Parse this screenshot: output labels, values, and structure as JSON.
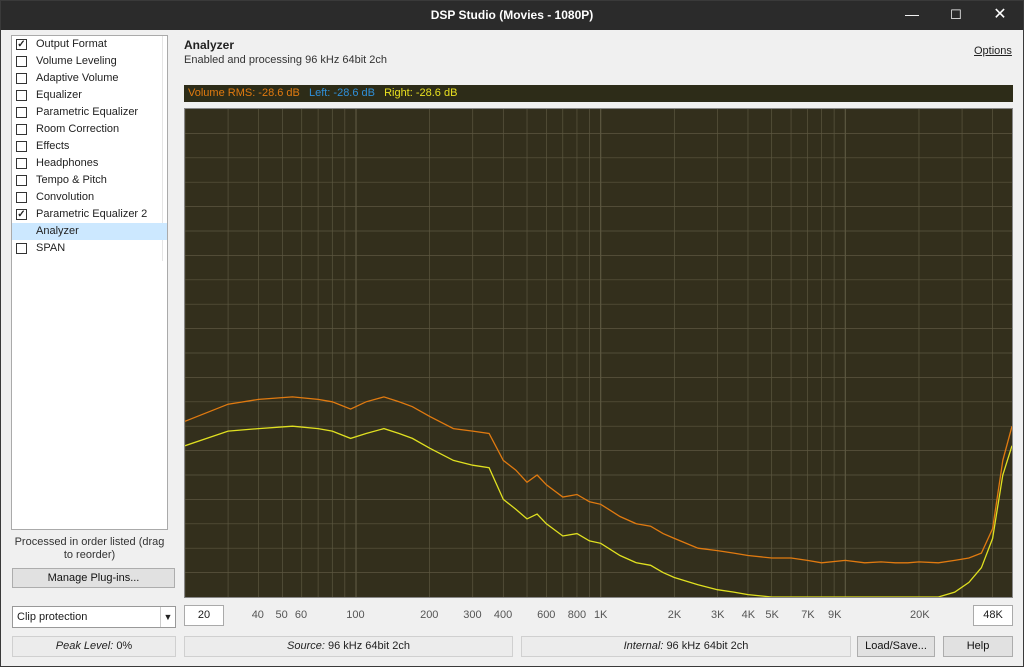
{
  "window": {
    "title": "DSP Studio (Movies - 1080P)",
    "minimize_glyph": "—",
    "maximize_glyph": "☐",
    "close_glyph": "✕"
  },
  "sidebar": {
    "items": [
      {
        "label": "Output Format",
        "checked": true
      },
      {
        "label": "Volume Leveling",
        "checked": false
      },
      {
        "label": "Adaptive Volume",
        "checked": false
      },
      {
        "label": "Equalizer",
        "checked": false
      },
      {
        "label": "Parametric Equalizer",
        "checked": false
      },
      {
        "label": "Room Correction",
        "checked": false
      },
      {
        "label": "Effects",
        "checked": false
      },
      {
        "label": "Headphones",
        "checked": false
      },
      {
        "label": "Tempo & Pitch",
        "checked": false
      },
      {
        "label": "Convolution",
        "checked": false
      },
      {
        "label": "Parametric Equalizer 2",
        "checked": true
      },
      {
        "label": "Analyzer",
        "checked": null,
        "selected": true
      },
      {
        "label": "SPAN",
        "checked": false
      }
    ],
    "order_note": "Processed in order listed (drag to reorder)",
    "manage_button": "Manage Plug-ins..."
  },
  "header": {
    "title": "Analyzer",
    "status": "Enabled and processing 96 kHz 64bit 2ch",
    "options_link": "Options"
  },
  "rms": {
    "volume": "Volume RMS: -28.6 dB",
    "left": "Left: -28.6 dB",
    "right": "Right: -28.6 dB",
    "volume_color": "#e07a10",
    "left_color": "#2f8fd8",
    "right_color": "#e8e020"
  },
  "frequency_range": {
    "min_value": "20",
    "max_value": "48K",
    "ticks": [
      "40",
      "50",
      "60",
      "100",
      "200",
      "300",
      "400",
      "600",
      "800",
      "1K",
      "2K",
      "3K",
      "4K",
      "5K",
      "7K",
      "9K",
      "20K"
    ]
  },
  "spectrum": {
    "x_hz": [
      20,
      30,
      40,
      55,
      70,
      80,
      95,
      110,
      130,
      150,
      170,
      200,
      250,
      300,
      350,
      400,
      450,
      500,
      550,
      600,
      700,
      800,
      900,
      1000,
      1200,
      1400,
      1600,
      1800,
      2000,
      2500,
      3000,
      3500,
      4000,
      5000,
      6000,
      7000,
      8000,
      10000,
      12000,
      14000,
      16000,
      18000,
      20000,
      24000,
      28000,
      32000,
      36000,
      40000,
      44000,
      48000
    ],
    "orange_level": [
      0.64,
      0.605,
      0.595,
      0.59,
      0.595,
      0.6,
      0.615,
      0.6,
      0.59,
      0.6,
      0.61,
      0.63,
      0.655,
      0.66,
      0.665,
      0.72,
      0.74,
      0.765,
      0.75,
      0.77,
      0.795,
      0.79,
      0.805,
      0.81,
      0.835,
      0.85,
      0.855,
      0.87,
      0.88,
      0.9,
      0.905,
      0.91,
      0.915,
      0.92,
      0.92,
      0.925,
      0.93,
      0.925,
      0.93,
      0.928,
      0.93,
      0.93,
      0.928,
      0.93,
      0.925,
      0.92,
      0.91,
      0.86,
      0.72,
      0.65
    ],
    "yellow_level": [
      0.69,
      0.66,
      0.655,
      0.65,
      0.655,
      0.66,
      0.675,
      0.665,
      0.655,
      0.665,
      0.675,
      0.695,
      0.72,
      0.73,
      0.735,
      0.8,
      0.82,
      0.84,
      0.83,
      0.85,
      0.875,
      0.87,
      0.885,
      0.89,
      0.915,
      0.93,
      0.935,
      0.95,
      0.96,
      0.975,
      0.985,
      0.99,
      0.995,
      1.0,
      1.0,
      1.0,
      1.0,
      1.0,
      1.0,
      1.0,
      1.0,
      1.0,
      1.0,
      1.0,
      0.99,
      0.97,
      0.94,
      0.88,
      0.75,
      0.69
    ],
    "orange_color": "#e07a10",
    "yellow_color": "#e0e020",
    "grid_color": "#5c5740",
    "background_color": "#332f1c"
  },
  "bottom": {
    "dropdown_value": "Clip protection",
    "peak_label": "Peak Level:",
    "peak_value": "0%",
    "source_label": "Source:",
    "source_value": "96 kHz 64bit 2ch",
    "internal_label": "Internal:",
    "internal_value": "96 kHz 64bit 2ch",
    "load_save": "Load/Save...",
    "help": "Help"
  }
}
